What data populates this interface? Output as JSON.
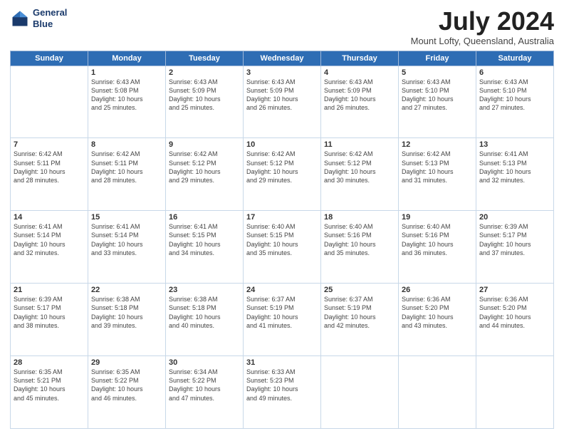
{
  "header": {
    "logo_line1": "General",
    "logo_line2": "Blue",
    "month_year": "July 2024",
    "location": "Mount Lofty, Queensland, Australia"
  },
  "weekdays": [
    "Sunday",
    "Monday",
    "Tuesday",
    "Wednesday",
    "Thursday",
    "Friday",
    "Saturday"
  ],
  "weeks": [
    [
      {
        "day": "",
        "info": ""
      },
      {
        "day": "1",
        "info": "Sunrise: 6:43 AM\nSunset: 5:08 PM\nDaylight: 10 hours\nand 25 minutes."
      },
      {
        "day": "2",
        "info": "Sunrise: 6:43 AM\nSunset: 5:09 PM\nDaylight: 10 hours\nand 25 minutes."
      },
      {
        "day": "3",
        "info": "Sunrise: 6:43 AM\nSunset: 5:09 PM\nDaylight: 10 hours\nand 26 minutes."
      },
      {
        "day": "4",
        "info": "Sunrise: 6:43 AM\nSunset: 5:09 PM\nDaylight: 10 hours\nand 26 minutes."
      },
      {
        "day": "5",
        "info": "Sunrise: 6:43 AM\nSunset: 5:10 PM\nDaylight: 10 hours\nand 27 minutes."
      },
      {
        "day": "6",
        "info": "Sunrise: 6:43 AM\nSunset: 5:10 PM\nDaylight: 10 hours\nand 27 minutes."
      }
    ],
    [
      {
        "day": "7",
        "info": "Sunrise: 6:42 AM\nSunset: 5:11 PM\nDaylight: 10 hours\nand 28 minutes."
      },
      {
        "day": "8",
        "info": "Sunrise: 6:42 AM\nSunset: 5:11 PM\nDaylight: 10 hours\nand 28 minutes."
      },
      {
        "day": "9",
        "info": "Sunrise: 6:42 AM\nSunset: 5:12 PM\nDaylight: 10 hours\nand 29 minutes."
      },
      {
        "day": "10",
        "info": "Sunrise: 6:42 AM\nSunset: 5:12 PM\nDaylight: 10 hours\nand 29 minutes."
      },
      {
        "day": "11",
        "info": "Sunrise: 6:42 AM\nSunset: 5:12 PM\nDaylight: 10 hours\nand 30 minutes."
      },
      {
        "day": "12",
        "info": "Sunrise: 6:42 AM\nSunset: 5:13 PM\nDaylight: 10 hours\nand 31 minutes."
      },
      {
        "day": "13",
        "info": "Sunrise: 6:41 AM\nSunset: 5:13 PM\nDaylight: 10 hours\nand 32 minutes."
      }
    ],
    [
      {
        "day": "14",
        "info": "Sunrise: 6:41 AM\nSunset: 5:14 PM\nDaylight: 10 hours\nand 32 minutes."
      },
      {
        "day": "15",
        "info": "Sunrise: 6:41 AM\nSunset: 5:14 PM\nDaylight: 10 hours\nand 33 minutes."
      },
      {
        "day": "16",
        "info": "Sunrise: 6:41 AM\nSunset: 5:15 PM\nDaylight: 10 hours\nand 34 minutes."
      },
      {
        "day": "17",
        "info": "Sunrise: 6:40 AM\nSunset: 5:15 PM\nDaylight: 10 hours\nand 35 minutes."
      },
      {
        "day": "18",
        "info": "Sunrise: 6:40 AM\nSunset: 5:16 PM\nDaylight: 10 hours\nand 35 minutes."
      },
      {
        "day": "19",
        "info": "Sunrise: 6:40 AM\nSunset: 5:16 PM\nDaylight: 10 hours\nand 36 minutes."
      },
      {
        "day": "20",
        "info": "Sunrise: 6:39 AM\nSunset: 5:17 PM\nDaylight: 10 hours\nand 37 minutes."
      }
    ],
    [
      {
        "day": "21",
        "info": "Sunrise: 6:39 AM\nSunset: 5:17 PM\nDaylight: 10 hours\nand 38 minutes."
      },
      {
        "day": "22",
        "info": "Sunrise: 6:38 AM\nSunset: 5:18 PM\nDaylight: 10 hours\nand 39 minutes."
      },
      {
        "day": "23",
        "info": "Sunrise: 6:38 AM\nSunset: 5:18 PM\nDaylight: 10 hours\nand 40 minutes."
      },
      {
        "day": "24",
        "info": "Sunrise: 6:37 AM\nSunset: 5:19 PM\nDaylight: 10 hours\nand 41 minutes."
      },
      {
        "day": "25",
        "info": "Sunrise: 6:37 AM\nSunset: 5:19 PM\nDaylight: 10 hours\nand 42 minutes."
      },
      {
        "day": "26",
        "info": "Sunrise: 6:36 AM\nSunset: 5:20 PM\nDaylight: 10 hours\nand 43 minutes."
      },
      {
        "day": "27",
        "info": "Sunrise: 6:36 AM\nSunset: 5:20 PM\nDaylight: 10 hours\nand 44 minutes."
      }
    ],
    [
      {
        "day": "28",
        "info": "Sunrise: 6:35 AM\nSunset: 5:21 PM\nDaylight: 10 hours\nand 45 minutes."
      },
      {
        "day": "29",
        "info": "Sunrise: 6:35 AM\nSunset: 5:22 PM\nDaylight: 10 hours\nand 46 minutes."
      },
      {
        "day": "30",
        "info": "Sunrise: 6:34 AM\nSunset: 5:22 PM\nDaylight: 10 hours\nand 47 minutes."
      },
      {
        "day": "31",
        "info": "Sunrise: 6:33 AM\nSunset: 5:23 PM\nDaylight: 10 hours\nand 49 minutes."
      },
      {
        "day": "",
        "info": ""
      },
      {
        "day": "",
        "info": ""
      },
      {
        "day": "",
        "info": ""
      }
    ]
  ]
}
